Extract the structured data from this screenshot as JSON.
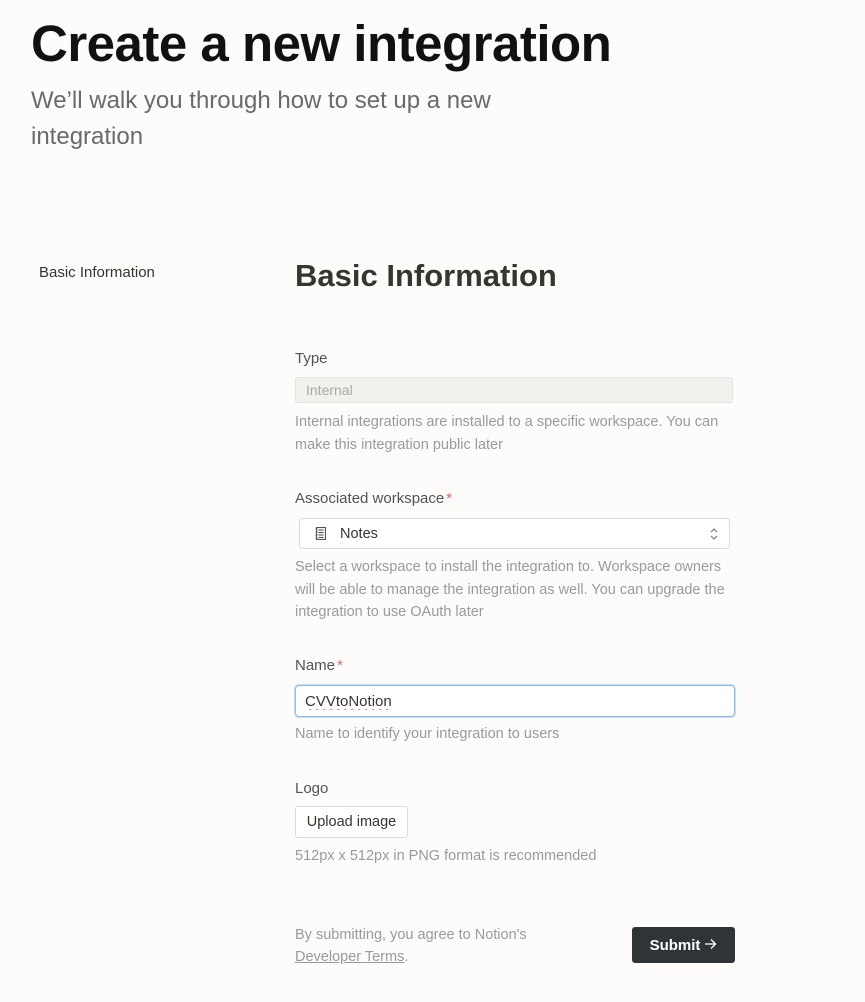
{
  "header": {
    "title": "Create a new integration",
    "subtitle": "We’ll walk you through how to set up a new integration"
  },
  "sidebar": {
    "items": [
      {
        "label": "Basic Information"
      }
    ]
  },
  "form": {
    "section_title": "Basic Information",
    "type": {
      "label": "Type",
      "value": "Internal",
      "help": "Internal integrations are installed to a specific workspace. You can make this integration public later"
    },
    "workspace": {
      "label": "Associated workspace",
      "required_mark": "*",
      "value": "Notes",
      "icon": "notebook-icon",
      "help": "Select a workspace to install the integration to. Workspace owners will be able to manage the integration as well. You can upgrade the integration to use OAuth later"
    },
    "name": {
      "label": "Name",
      "required_mark": "*",
      "value": "CVVtoNotion",
      "help": "Name to identify your integration to users"
    },
    "logo": {
      "label": "Logo",
      "button_label": "Upload image",
      "help": "512px x 512px in PNG format is recommended"
    }
  },
  "footer": {
    "terms_prefix": "By submitting, you agree to Notion's",
    "terms_link": "Developer Terms",
    "terms_suffix": ".",
    "submit_label": "Submit",
    "submit_icon": "arrow-right-icon"
  }
}
